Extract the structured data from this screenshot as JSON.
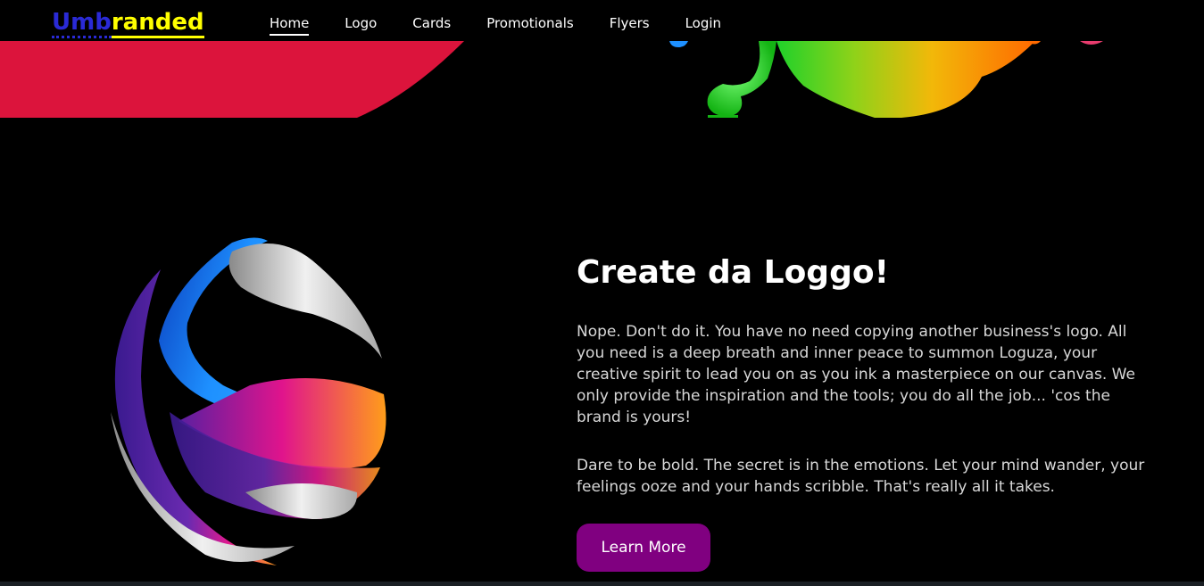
{
  "brand": {
    "part1": "Umb",
    "part2": "randed",
    "color1": "#2a2ad6",
    "color2": "#ffff00"
  },
  "nav": {
    "items": [
      {
        "label": "Home"
      },
      {
        "label": "Logo"
      },
      {
        "label": "Cards"
      },
      {
        "label": "Promotionals"
      },
      {
        "label": "Flyers"
      },
      {
        "label": "Login"
      }
    ]
  },
  "main": {
    "title": "Create da Loggo!",
    "paragraph1": "Nope. Don't do it. You have no need copying another business's logo. All you need is a deep breath and inner peace to summon Loguza, your creative spirit to lead you on as you ink a masterpiece on our canvas. We only provide the inspiration and the tools; you do all the job... 'cos the brand is yours!",
    "paragraph2": "Dare to be bold. The secret is in the emotions. Let your mind wander, your feelings ooze and your hands scribble. That's really all it takes.",
    "button_label": "Learn More"
  },
  "colors": {
    "accent": "#800080",
    "hero_red": "#dc143c",
    "background": "#000000"
  },
  "icons": {
    "hero": "paint-splash-icon",
    "feature": "ribbon-globe-icon"
  }
}
